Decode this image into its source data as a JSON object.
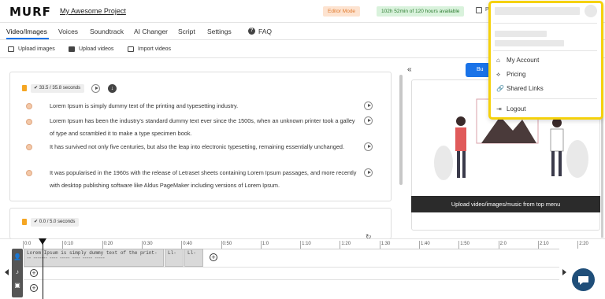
{
  "header": {
    "logo": "MURF",
    "project_title": "My Awesome Project",
    "editor_mode": "Editor Mode",
    "hours_available": "102h 52min of 120 hours available",
    "publish_label": "Pu"
  },
  "tabs": [
    {
      "label": "Video/Images"
    },
    {
      "label": "Voices"
    },
    {
      "label": "Soundtrack"
    },
    {
      "label": "AI Changer"
    },
    {
      "label": "Script"
    },
    {
      "label": "Settings"
    },
    {
      "label": "FAQ"
    }
  ],
  "upload": {
    "images": "Upload images",
    "videos": "Upload videos",
    "import": "Import videos"
  },
  "blocks": [
    {
      "duration": "33.5 / 35.8 seconds",
      "paragraphs": [
        "Lorem Ipsum is simply dummy text of the printing and typesetting industry.",
        "Lorem Ipsum has been the industry's standard dummy text ever since the 1500s, when an unknown printer took a galley of type and scrambled it to make a type specimen book.",
        "It has survived not only five centuries, but also the leap into electronic typesetting, remaining essentially unchanged.",
        "It was popularised in the 1960s with the release of Letraset sheets containing Lorem Ipsum passages, and more recently with desktop publishing software like Aldus PageMaker including versions of Lorem Ipsum."
      ]
    },
    {
      "duration": "0.0 / 5.0 seconds",
      "paragraphs": []
    }
  ],
  "preview": {
    "build_label": "Bu",
    "caption": "Upload video/images/music from top menu"
  },
  "timeline": {
    "ticks": [
      "0:0",
      "0:10",
      "0:20",
      "0:30",
      "0:40",
      "0:50",
      "1:0",
      "1:10",
      "1:20",
      "1:30",
      "1:40",
      "1:50",
      "2:0",
      "2:10",
      "2:20"
    ],
    "clips": [
      {
        "text": "Lorem Ipsum is simply dummy text of the print-"
      },
      {
        "text": "Ll-"
      },
      {
        "text": "Ll-"
      }
    ]
  },
  "dropdown": {
    "items": [
      {
        "label": "My Account",
        "icon": "home-icon"
      },
      {
        "label": "Pricing",
        "icon": "pricing-icon"
      },
      {
        "label": "Shared Links",
        "icon": "link-icon"
      },
      {
        "label": "Logout",
        "icon": "logout-icon"
      }
    ],
    "border_color": "#f5d10b"
  },
  "colors": {
    "accent": "#1a73e8",
    "editor_mode_bg": "#fde3d0",
    "hours_bg": "#d9f2dc"
  }
}
